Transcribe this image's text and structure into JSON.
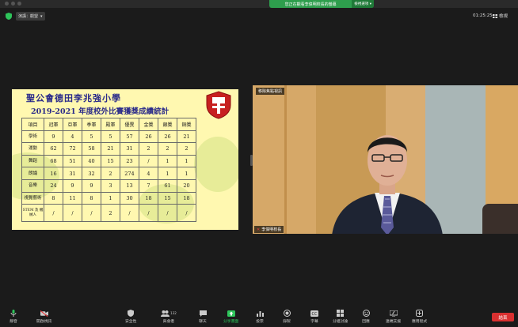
{
  "top": {
    "share_banner": "您正在觀看李偉明校長的螢幕",
    "view_options": "檢視選項"
  },
  "viewbar": {
    "view_button": "演講：觀望",
    "time": "01:25:25",
    "view_label": "檢視"
  },
  "slide": {
    "school": "聖公會德田李兆強小學",
    "title": "2019-2021 年度校外比賽獲獎成績統計",
    "columns": [
      "項目",
      "冠軍",
      "亞軍",
      "季軍",
      "殿軍",
      "優異",
      "金獎",
      "銀獎",
      "銅獎"
    ],
    "rows": [
      {
        "name": "學術",
        "vals": [
          "9",
          "4",
          "5",
          "5",
          "57",
          "26",
          "26",
          "21"
        ]
      },
      {
        "name": "運動",
        "vals": [
          "62",
          "72",
          "58",
          "21",
          "31",
          "2",
          "2",
          "2"
        ]
      },
      {
        "name": "舞蹈",
        "vals": [
          "68",
          "51",
          "40",
          "15",
          "23",
          "/",
          "1",
          "1"
        ]
      },
      {
        "name": "朗誦",
        "vals": [
          "16",
          "31",
          "32",
          "2",
          "274",
          "4",
          "1",
          "1"
        ]
      },
      {
        "name": "音樂",
        "vals": [
          "24",
          "9",
          "9",
          "3",
          "13",
          "7",
          "61",
          "20"
        ]
      },
      {
        "name": "視覺藝術",
        "vals": [
          "8",
          "11",
          "8",
          "1",
          "30",
          "18",
          "15",
          "18"
        ]
      },
      {
        "name": "STEM 及 機械人",
        "vals": [
          "/",
          "/",
          "/",
          "2",
          "/",
          "/",
          "/",
          "/"
        ]
      }
    ]
  },
  "video": {
    "tile_top_label": "移除焦點視訊",
    "tile_bottom_label": "李偉明校長"
  },
  "toolbar": {
    "mute": "靜音",
    "video": "開啟視訊",
    "security": "安全性",
    "participants": "與會者",
    "participants_count": "132",
    "chat": "聊天",
    "share": "分享畫面",
    "polls": "投票",
    "record": "錄製",
    "captions": "字幕",
    "breakout": "分組討論",
    "reactions": "回應",
    "remote": "遠端支援",
    "apps": "應用程式",
    "end": "結束"
  },
  "colors": {
    "accent_green": "#2ec55b",
    "end_red": "#d93030",
    "slide_bg": "#fff8b0",
    "title_blue": "#2a2a8a"
  }
}
